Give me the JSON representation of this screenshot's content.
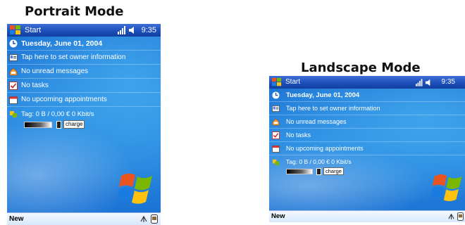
{
  "portrait_title": "Portrait Mode",
  "landscape_title": "Landscape Mode",
  "device": {
    "start_label": "Start",
    "time": "9:35",
    "status_icons": "signal-speaker-icons",
    "rows": {
      "date": "Tuesday, June 01, 2004",
      "owner": "Tap here to set owner information",
      "messages": "No unread messages",
      "tasks": "No tasks",
      "appointments": "No upcoming appointments",
      "traffic": "Tag: 0 B / 0,00 € 0 Kbit/s",
      "charge": "charge"
    },
    "softkey_left": "New",
    "colors": {
      "title_bar": "#1c4fba",
      "wallpaper": "#2e8fe3",
      "soft_bar": "#d7e8fb"
    }
  }
}
